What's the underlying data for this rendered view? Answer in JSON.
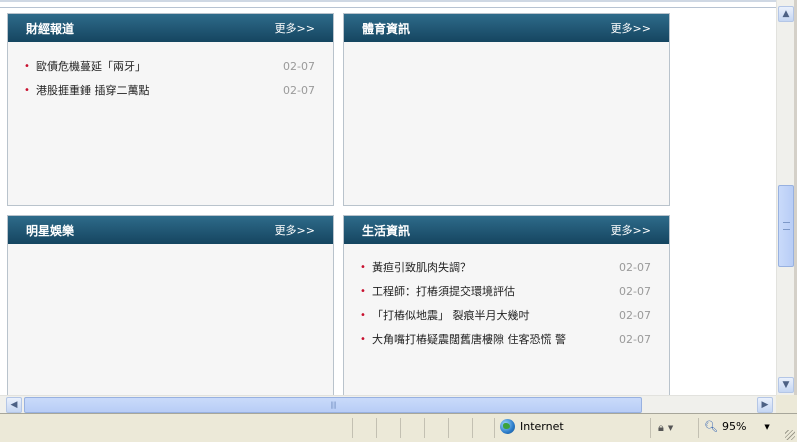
{
  "panels": {
    "finance": {
      "title": "財經報道",
      "more": "更多>>",
      "items": [
        {
          "text": "歐債危機蔓延「兩牙」",
          "date": "02-07"
        },
        {
          "text": "港股捱重錘 插穿二萬點",
          "date": "02-07"
        }
      ]
    },
    "sports": {
      "title": "體育資訊",
      "more": "更多>>",
      "items": []
    },
    "entertainment": {
      "title": "明星娛樂",
      "more": "更多>>",
      "items": []
    },
    "lifestyle": {
      "title": "生活資訊",
      "more": "更多>>",
      "items": [
        {
          "text": "黃疸引致肌肉失調？",
          "date": "02-07"
        },
        {
          "text": "工程師：打樁須提交環境評估",
          "date": "02-07"
        },
        {
          "text": "「打樁似地震」 裂痕半月大幾吋",
          "date": "02-07"
        },
        {
          "text": "大角嘴打樁疑震闊舊唐樓隙 住客恐慌 警",
          "date": "02-07"
        }
      ]
    }
  },
  "statusbar": {
    "zone": "Internet",
    "zoom": "95%"
  },
  "icons": {
    "zone": "globe-icon",
    "security": "lock-icon",
    "zoom": "magnifier-icon"
  },
  "colors": {
    "header_bg": "#1f5570",
    "bullet": "#c8102e",
    "date": "#9a9a9a"
  }
}
